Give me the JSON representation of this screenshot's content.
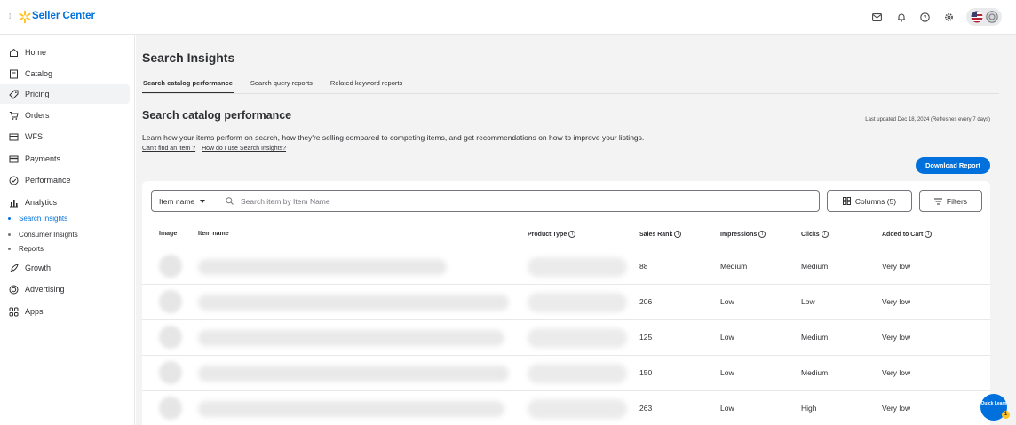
{
  "header": {
    "grid_icon": "grid-icon",
    "brand": "Seller Center",
    "icons": [
      "mail-icon",
      "bell-icon",
      "help-icon",
      "settings-icon",
      "us-flag-icon",
      "account-icon"
    ]
  },
  "sidebar": {
    "items": [
      {
        "label": "Home",
        "icon": "home-icon"
      },
      {
        "label": "Catalog",
        "icon": "catalog-icon"
      },
      {
        "label": "Pricing",
        "icon": "tag-icon"
      },
      {
        "label": "Orders",
        "icon": "cart-icon"
      },
      {
        "label": "WFS",
        "icon": "truck-icon"
      },
      {
        "label": "Payments",
        "icon": "wallet-icon"
      },
      {
        "label": "Performance",
        "icon": "gauge-icon"
      },
      {
        "label": "Analytics",
        "icon": "bar-chart-icon"
      }
    ],
    "analytics_sub": [
      "Search Insights",
      "Consumer Insights",
      "Reports"
    ],
    "items_after": [
      {
        "label": "Growth",
        "icon": "rocket-icon"
      },
      {
        "label": "Advertising",
        "icon": "advertising-icon"
      },
      {
        "label": "Apps",
        "icon": "apps-icon"
      }
    ]
  },
  "main": {
    "page_title": "Search Insights",
    "tabs": [
      "Search catalog performance",
      "Search query reports",
      "Related keyword reports"
    ],
    "section_title": "Search catalog performance",
    "last_updated": "Last updated Dec 18, 2024 (Refreshes every 7 days)",
    "description": "Learn how your items perform on search, how they're selling compared to competing items, and get recommendations on how to improve your listings.",
    "link_1": "Can't find an item ?",
    "link_2": "How do I use Search Insights?",
    "download_button": "Download Report"
  },
  "table": {
    "filter_select": "Item name",
    "search_placeholder": "Search item by Item Name",
    "columns_button": "Columns (5)",
    "filters_button": "Filters",
    "headers": {
      "image": "Image",
      "item_name": "Item name",
      "product_type": "Product Type",
      "sales_rank": "Sales Rank",
      "impressions": "Impressions",
      "clicks": "Clicks",
      "added_to_cart": "Added to Cart"
    },
    "rows": [
      {
        "sales_rank": "88",
        "impressions": "Medium",
        "clicks": "Medium",
        "added_to_cart": "Very low"
      },
      {
        "sales_rank": "206",
        "impressions": "Low",
        "clicks": "Low",
        "added_to_cart": "Very low"
      },
      {
        "sales_rank": "125",
        "impressions": "Low",
        "clicks": "Medium",
        "added_to_cart": "Very low"
      },
      {
        "sales_rank": "150",
        "impressions": "Low",
        "clicks": "Medium",
        "added_to_cart": "Very low"
      },
      {
        "sales_rank": "263",
        "impressions": "Low",
        "clicks": "High",
        "added_to_cart": "Very low"
      }
    ]
  },
  "quick_learn": {
    "label": "Quick Learn",
    "badge": "1"
  },
  "colors": {
    "brand_blue": "#0071dc",
    "spark_yellow": "#ffc220"
  }
}
